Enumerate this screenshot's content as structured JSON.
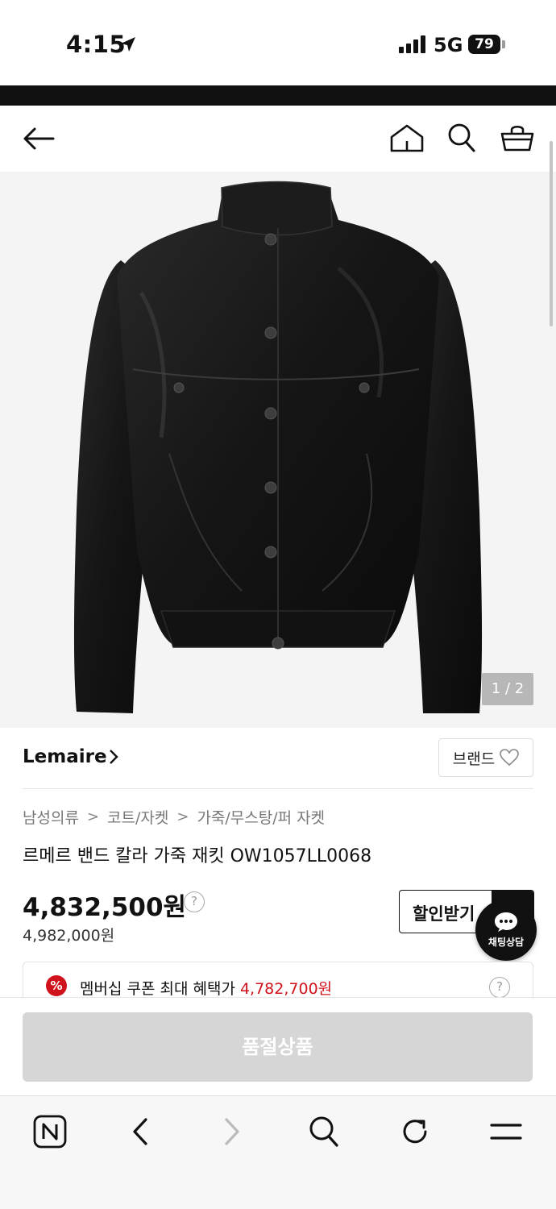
{
  "status_bar": {
    "time": "4:15",
    "network": "5G",
    "battery": "79"
  },
  "image": {
    "counter": "1 / 2"
  },
  "brand": {
    "name": "Lemaire",
    "button_label": "브랜드"
  },
  "breadcrumb": [
    "남성의류",
    "코트/자켓",
    "가죽/무스탕/퍼 자켓"
  ],
  "breadcrumb_separator": ">",
  "product": {
    "title": "르메르 밴드 칼라 가죽 재킷 OW1057LL0068",
    "sale_price": "4,832,500원",
    "original_price": "4,982,000원",
    "help": "?"
  },
  "discount_button": {
    "label": "할인받기"
  },
  "chat": {
    "label": "채팅상담"
  },
  "coupon": {
    "icon": "%",
    "text": "멤버십 쿠폰 최대 혜택가",
    "price": "4,782,700원",
    "help": "?",
    "price_color": "#d0121c"
  },
  "cta": {
    "label": "품절상품"
  },
  "icons": {
    "header": [
      "back-arrow-icon",
      "home-icon",
      "search-icon",
      "cart-icon"
    ],
    "toolbar": [
      "naver-n-icon",
      "back-chevron-icon",
      "forward-chevron-icon",
      "search-icon",
      "refresh-icon",
      "menu-icon"
    ]
  }
}
